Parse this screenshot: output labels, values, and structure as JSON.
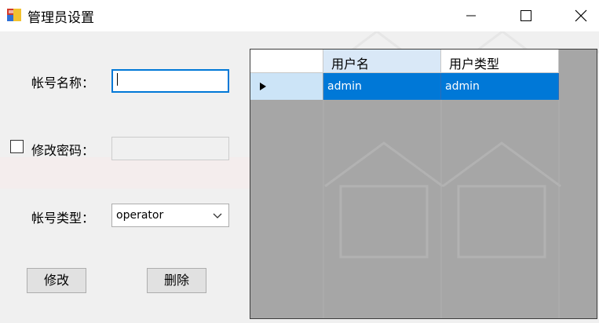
{
  "window": {
    "title": "管理员设置",
    "controls": [
      "minimize-icon",
      "maximize-icon",
      "close-icon"
    ]
  },
  "form": {
    "account_name_label": "帐号名称：",
    "account_name_value": "",
    "change_password_label": "修改密码：",
    "change_password_checked": false,
    "password_value": "",
    "account_type_label": "帐号类型：",
    "account_type_selected": "operator",
    "modify_button": "修改",
    "delete_button": "删除"
  },
  "grid": {
    "columns": [
      "用户名",
      "用户类型"
    ],
    "rows": [
      {
        "username": "admin",
        "usertype": "admin",
        "selected": true
      }
    ]
  },
  "colors": {
    "accent": "#0078d7",
    "grid_background": "#a6a6a6",
    "row_header_selected": "#cce4f7"
  }
}
